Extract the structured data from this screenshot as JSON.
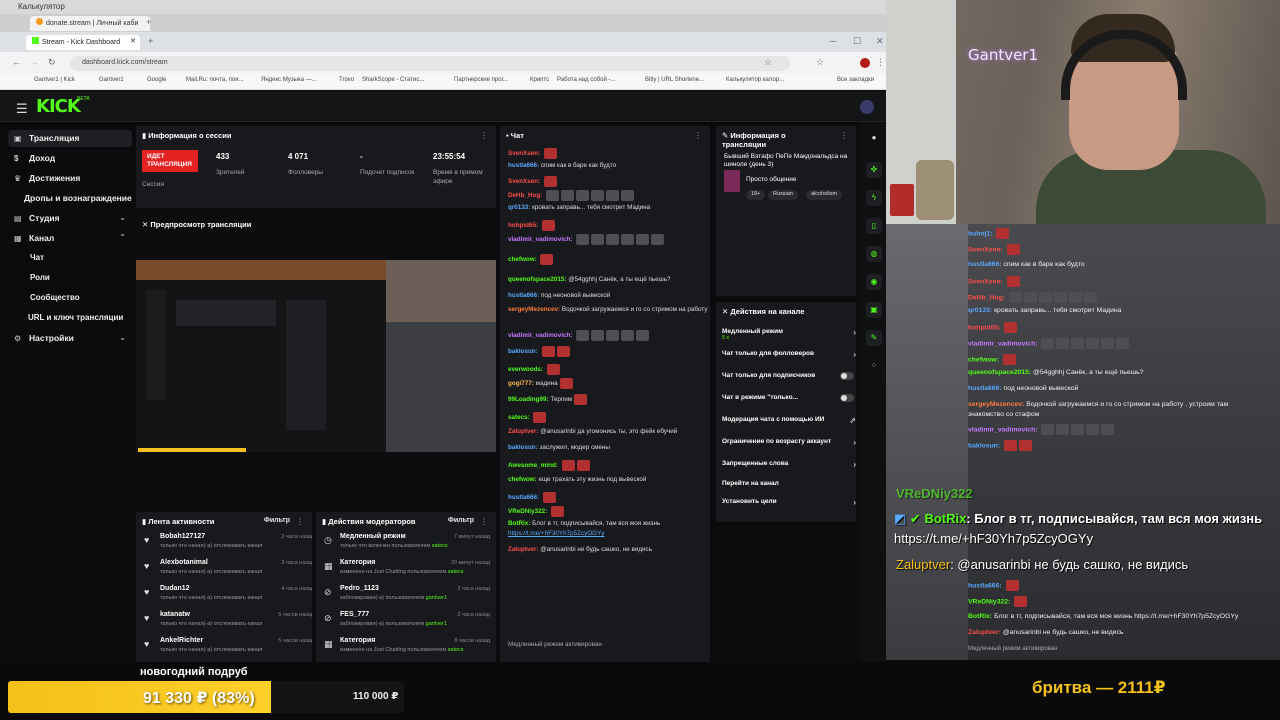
{
  "window": {
    "bg_title": "Калькулятор",
    "bg_tab1": "donate.stream | Личный каби",
    "tab_active": "Stream - Kick Dashboard",
    "url": "dashboard.kick.com/stream",
    "bookmarks": [
      "Gantver1 | Kick",
      "Gantver1",
      "Google",
      "Mail.Ru: почта, пои...",
      "Яндекс Музыка —...",
      "Trovo",
      "SharkScope - Статис...",
      "Партнерские прог...",
      "Криптс",
      "Работа над собой -...",
      "Bitly | URL Shortene...",
      "Калькулятор калор...",
      "Все закладки"
    ]
  },
  "kick": {
    "logo": "KICK",
    "beta": "BETA",
    "sidebar": [
      {
        "label": "Трансляция",
        "icon": "stream-icon"
      },
      {
        "label": "Доход",
        "icon": "dollar-icon"
      },
      {
        "label": "Достижения",
        "icon": "trophy-icon"
      },
      {
        "label": "Дропы и вознаграждение",
        "icon": ""
      },
      {
        "label": "Студия",
        "icon": "studio-icon"
      },
      {
        "label": "Канал",
        "icon": "channel-icon"
      },
      {
        "label": "Настройки",
        "icon": "gear-icon"
      }
    ],
    "channel_sub": [
      "Чат",
      "Роли",
      "Сообщество",
      "URL и ключ трансляции"
    ],
    "session": {
      "title": "Информация о сессии",
      "live": "ИДЕТ ТРАНСЛЯЦИЯ",
      "session_label": "Сессия",
      "viewers": "433",
      "viewers_label": "Зрителей",
      "followers": "4 071",
      "followers_label": "Фолловеры",
      "subs": "-",
      "subs_label": "Подсчет подписок",
      "uptime": "23:55:54",
      "uptime_label": "Время в прямом эфире"
    },
    "preview_title": "Предпросмотр трансляции",
    "chat": {
      "title": "Чат",
      "messages": [
        {
          "user": "SvenXsen:",
          "color": "#ff4d4d",
          "text": "",
          "emotes": 1
        },
        {
          "user": "hustla666:",
          "color": "#5aa9ff",
          "text": "спим как в баре как будто",
          "emotes": 0
        },
        {
          "user": "SvenXsen:",
          "color": "#ff4d4d",
          "text": "",
          "emotes": 1
        },
        {
          "user": "DeHb_Hog:",
          "color": "#ff4d4d",
          "text": "",
          "emotes": 6
        },
        {
          "user": "qr0133:",
          "color": "#5aa9ff",
          "text": "кровать заправь... тебя смотрит Мадина",
          "emotes": 0
        },
        {
          "user": "hohpid65:",
          "color": "#ff4d4d",
          "text": "",
          "emotes": 1
        },
        {
          "user": "vladimir_vadimovich:",
          "color": "#c27bff",
          "text": "",
          "emotes": 6
        },
        {
          "user": "chefwow:",
          "color": "#53fc18",
          "text": "",
          "emotes": 1
        },
        {
          "user": "queenofspace2015:",
          "color": "#53fc18",
          "text": "@54gghhj Санёк, а ты ещё пьешь?",
          "emotes": 0
        },
        {
          "user": "hustla666:",
          "color": "#5aa9ff",
          "text": "под неоновой вывеской",
          "emotes": 0
        },
        {
          "user": "sergeyMezencev:",
          "color": "#ff7a3d",
          "text": "Водочкой загружаемся и го со стримом на работу , устроим там знакомство со стафом",
          "emotes": 0
        },
        {
          "user": "vladimir_vadimovich:",
          "color": "#c27bff",
          "text": "",
          "emotes": 5
        },
        {
          "user": "baklosun:",
          "color": "#5aa9ff",
          "text": "",
          "emotes": 2
        },
        {
          "user": "everwoods:",
          "color": "#53fc18",
          "text": "",
          "emotes": 1
        },
        {
          "user": "gogi777:",
          "color": "#ffb84d",
          "text": "мадина",
          "emotes": 1
        },
        {
          "user": "99Loading99:",
          "color": "#53fc18",
          "text": "Терпим",
          "emotes": 1
        },
        {
          "user": "satecs:",
          "color": "#53fc18",
          "text": "",
          "emotes": 1
        },
        {
          "user": "Zaluptver:",
          "color": "#ff4d4d",
          "text": "@anusarinbi да угомонись ты, это фейк ебучий",
          "emotes": 0
        },
        {
          "user": "baklosun:",
          "color": "#5aa9ff",
          "text": "заслужил, модер смены",
          "emotes": 0
        },
        {
          "user": "Awesome_mind:",
          "color": "#53fc18",
          "text": "",
          "emotes": 2
        },
        {
          "user": "chefwow:",
          "color": "#53fc18",
          "text": "еще трахать эту жизнь под вывеской",
          "emotes": 0
        },
        {
          "user": "hustla666:",
          "color": "#5aa9ff",
          "text": "",
          "emotes": 1
        },
        {
          "user": "VReDNiy322:",
          "color": "#53fc18",
          "text": "",
          "emotes": 1
        },
        {
          "user": "BotRix:",
          "color": "#53fc18",
          "text": "Блог в тг, подписывайся, там вся моя жизнь",
          "emotes": 0
        },
        {
          "user": "",
          "color": "#5aa9ff",
          "text": "https://t.me/+hF30Yh7p5ZcyOGYy",
          "emotes": 0
        },
        {
          "user": "Zaluptver:",
          "color": "#ff4d4d",
          "text": "@anusarinbi не будь сашко, не видись",
          "emotes": 0
        }
      ],
      "slow_mode": "Медленный режим активирован"
    },
    "stream_info": {
      "title": "Информация о трансляции",
      "name": "Бывший Вэтафо ПеПе Макдональдса на шиноле (день 3)",
      "category": "Просто общение",
      "tags": [
        "18+",
        "Russian",
        "alcoholism"
      ]
    },
    "channel_actions": {
      "title": "Действия на канале",
      "items": [
        {
          "label": "Медленный режим",
          "sub": "5 с",
          "type": "arrow"
        },
        {
          "label": "Чат только для фолловеров",
          "type": "arrow"
        },
        {
          "label": "Чат только для подписчиков",
          "type": "toggle"
        },
        {
          "label": "Чат в режиме \"только...",
          "type": "toggle"
        },
        {
          "label": "Модерация чата с помощью ИИ",
          "type": "link"
        },
        {
          "label": "Ограничение по возрасту аккаунт",
          "type": "arrow"
        },
        {
          "label": "Запрещенные слова",
          "type": "arrow"
        },
        {
          "label": "Перейти на канал",
          "type": "none"
        },
        {
          "label": "Установить цели",
          "type": "arrow"
        }
      ]
    },
    "activity": {
      "title": "Лента активности",
      "filter": "Фильтр",
      "items": [
        {
          "name": "Bobah127127",
          "sub": "только что начал(-а) отслеживать канал",
          "time": "2 часа назад"
        },
        {
          "name": "Alexbotanimal",
          "sub": "только что начал(-а) отслеживать канал",
          "time": "3 часа назад"
        },
        {
          "name": "Dudan12",
          "sub": "только что начал(-а) отслеживать канал",
          "time": "4 часа назад"
        },
        {
          "name": "katanatw",
          "sub": "только что начал(-а) отслеживать канал",
          "time": "5 часов назад"
        },
        {
          "name": "AnkelRichter",
          "sub": "только что начал(-а) отслеживать канал",
          "time": "5 часов назад"
        }
      ]
    },
    "mod_actions": {
      "title": "Действия модераторов",
      "filter": "Фильтр",
      "items": [
        {
          "name": "Медленный режим",
          "sub": "только что включен пользователем",
          "who": "satecs",
          "time": "7 минут назад"
        },
        {
          "name": "Категория",
          "sub": "изменено на Just Chatting пользователем",
          "who": "satecs",
          "time": "20 минут назад"
        },
        {
          "name": "Pedro_1123",
          "sub": "заблокирован(-а) пользователем",
          "who": "gantver1",
          "time": "2 часа назад"
        },
        {
          "name": "FES_777",
          "sub": "заблокирован(-а) пользователем",
          "who": "gantver1",
          "time": "2 часа назад"
        },
        {
          "name": "Категория",
          "sub": "изменено на Just Chatting пользователем",
          "who": "satecs",
          "time": "8 часов назад"
        }
      ]
    }
  },
  "overlay": {
    "nick": "Gantver1",
    "chat": [
      {
        "user": "buhoj1:",
        "color": "#5aa9ff",
        "text": "",
        "emotes": 1
      },
      {
        "user": "SvenXsen:",
        "color": "#ff4d4d",
        "text": "",
        "emotes": 1
      },
      {
        "user": "hustla666:",
        "color": "#5aa9ff",
        "text": "спим как в баре как будто",
        "emotes": 0
      },
      {
        "user": "SvenXsen:",
        "color": "#ff4d4d",
        "text": "",
        "emotes": 1
      },
      {
        "user": "DeHb_Hog:",
        "color": "#ff4d4d",
        "text": "",
        "emotes": 6
      },
      {
        "user": "qr0133:",
        "color": "#5aa9ff",
        "text": "кровать заправь... тебя смотрит Мадина",
        "emotes": 0
      },
      {
        "user": "hohpid65:",
        "color": "#ff4d4d",
        "text": "",
        "emotes": 1
      },
      {
        "user": "vladimir_vadimovich:",
        "color": "#c27bff",
        "text": "",
        "emotes": 6
      },
      {
        "user": "chefwow:",
        "color": "#53fc18",
        "text": "",
        "emotes": 1
      },
      {
        "user": "queenofspace2015:",
        "color": "#53fc18",
        "text": "@54gghhj Санёк, а ты ещё пьешь?",
        "emotes": 0
      },
      {
        "user": "hustla666:",
        "color": "#5aa9ff",
        "text": "под неоновой вывеской",
        "emotes": 0
      },
      {
        "user": "sergeyMezencev:",
        "color": "#ff7a3d",
        "text": "Водочкой загружаемся и го со стримом на работу , устроим там",
        "emotes": 0
      },
      {
        "user": "",
        "color": "#ffffff",
        "text": "знакомство со стафом",
        "emotes": 0
      },
      {
        "user": "vladimir_vadimovich:",
        "color": "#c27bff",
        "text": "",
        "emotes": 5
      },
      {
        "user": "baklosun:",
        "color": "#5aa9ff",
        "text": "",
        "emotes": 2
      }
    ],
    "tail": [
      {
        "user": "hustla666:",
        "color": "#5aa9ff",
        "text": "",
        "emotes": 1
      },
      {
        "user": "VReDNiy322:",
        "color": "#53fc18",
        "text": "",
        "emotes": 1
      },
      {
        "user": "BotRix:",
        "color": "#53fc18",
        "text": "Блог в тг, подписывайся, там вся моя жизнь https://t.me/+hF30Yh7p5ZcyOGYy",
        "emotes": 0
      },
      {
        "user": "Zaluptver:",
        "color": "#ff4d4d",
        "text": "@anusarinbi не будь сашко, не видись",
        "emotes": 0
      }
    ],
    "big_botrix_user": "BotRix",
    "big_botrix_text": ": Блог в тг, подписывайся, там вся моя жизнь",
    "big_link": "https://t.me/+hF30Yh7p5ZcyOGYy",
    "big_zal_user": "Zaluptver",
    "big_zal_text": ": @anusarinbi не будь сашко, не видись",
    "big_vred": "VReDNiy322",
    "slow_mode": "Медленный режим активирован"
  },
  "goal": {
    "title": "новогодний подруб",
    "amount": "91 330 ₽ (83%)",
    "target": "110 000 ₽",
    "progress": 0.83
  },
  "ticker": "бритва — 2111₽",
  "colors": {
    "kick_green": "#53fc18",
    "live_red": "#e52222",
    "goal_yellow": "#f4c01a"
  }
}
